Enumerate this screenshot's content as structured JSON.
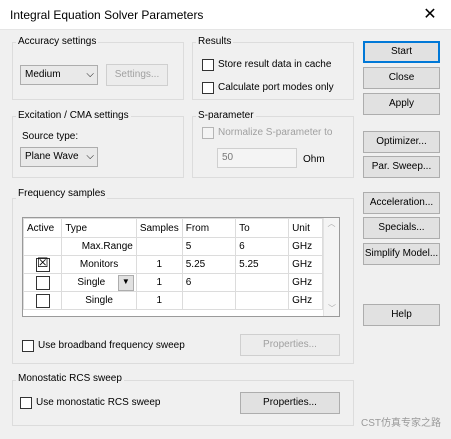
{
  "window": {
    "title": "Integral Equation Solver Parameters",
    "close_glyph": "✕"
  },
  "accuracy": {
    "label": "Accuracy settings",
    "value": "Medium",
    "settings_label": "Settings..."
  },
  "results": {
    "label": "Results",
    "store_label": "Store result data in cache",
    "calc_port_label": "Calculate port modes only"
  },
  "excitation": {
    "label": "Excitation / CMA settings",
    "source_type_label": "Source type:",
    "source_type_value": "Plane Wave"
  },
  "sparam": {
    "label": "S-parameter",
    "normalize_label": "Normalize S-parameter to",
    "value": "50",
    "unit": "Ohm"
  },
  "freq": {
    "label": "Frequency samples",
    "headers": [
      "Active",
      "Type",
      "Samples",
      "From",
      "To",
      "Unit"
    ],
    "rows": [
      {
        "active": "",
        "type": "Max.Range",
        "samples": "",
        "from": "5",
        "to": "6",
        "unit": "GHz"
      },
      {
        "active": "☒",
        "type": "Monitors",
        "samples": "1",
        "from": "5.25",
        "to": "5.25",
        "unit": "GHz"
      },
      {
        "active": "",
        "type": "Single",
        "samples": "1",
        "from": "6",
        "to": "",
        "unit": "GHz"
      },
      {
        "active": "",
        "type": "Single",
        "samples": "1",
        "from": "",
        "to": "",
        "unit": "GHz"
      }
    ],
    "broadband_label": "Use broadband frequency sweep",
    "properties_label": "Properties..."
  },
  "rcs": {
    "label": "Monostatic RCS sweep",
    "use_label": "Use monostatic RCS sweep",
    "properties_label": "Properties..."
  },
  "buttons": {
    "start": "Start",
    "close": "Close",
    "apply": "Apply",
    "optimizer": "Optimizer...",
    "par_sweep": "Par. Sweep...",
    "acceleration": "Acceleration...",
    "specials": "Specials...",
    "simplify": "Simplify Model...",
    "help": "Help"
  },
  "watermark": "CST仿真专家之路"
}
